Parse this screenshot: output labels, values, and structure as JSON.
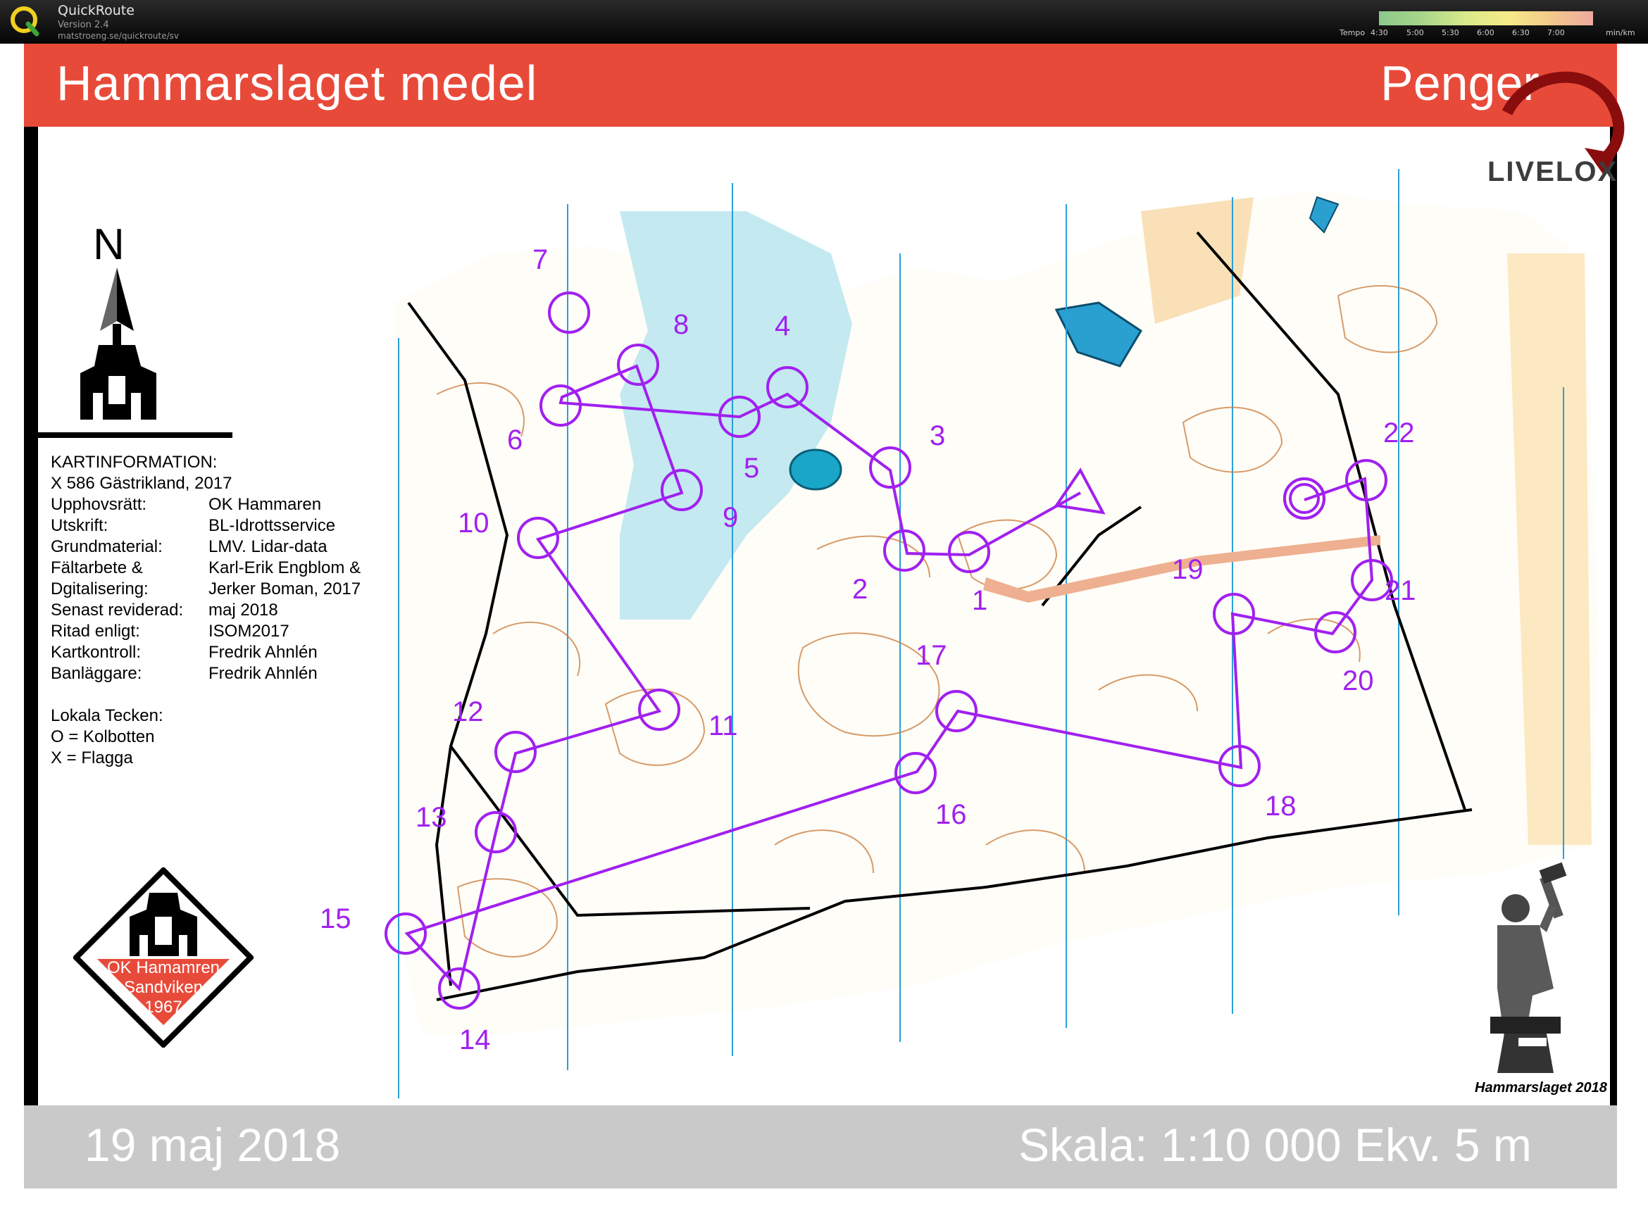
{
  "window": {
    "app_name": "QuickRoute",
    "version": "Version 2.4",
    "url": "matstroeng.se/quickroute/sv",
    "app_icon": "quickroute-q-icon"
  },
  "tempo_legend": {
    "label": "Tempo",
    "ticks": [
      "4:30",
      "5:00",
      "5:30",
      "6:00",
      "6:30",
      "7:00"
    ],
    "unit": "min/km",
    "gradient_colors": [
      "#8cc88c",
      "#d8ea8a",
      "#f6ea88",
      "#eeaaa0"
    ]
  },
  "map": {
    "title": "Hammarslaget medel",
    "course": "Penger",
    "brand": "LIVELOX",
    "north_label": "N",
    "info": {
      "heading": "KARTINFORMATION:",
      "map_id": "X 586 Gästrikland, 2017",
      "rows": [
        {
          "k": "Upphovsrätt:",
          "v": "OK Hammaren"
        },
        {
          "k": "Utskrift:",
          "v": "BL-Idrottsservice"
        },
        {
          "k": "Grundmaterial:",
          "v": "LMV. Lidar-data"
        },
        {
          "k": "Fältarbete &",
          "v": "Karl-Erik Engblom &"
        },
        {
          "k": "Dgitalisering:",
          "v": "Jerker Boman, 2017"
        },
        {
          "k": "Senast reviderad:",
          "v": "maj 2018"
        },
        {
          "k": "Ritad enligt:",
          "v": "ISOM2017"
        },
        {
          "k": "Kartkontroll:",
          "v": "Fredrik Ahnlén"
        },
        {
          "k": "Banläggare:",
          "v": "Fredrik Ahnlén"
        }
      ],
      "local_heading": "Lokala Tecken:",
      "local_1": "O = Kolbotten",
      "local_2": "X = Flagga"
    },
    "club": {
      "line1": "OK Hamamren",
      "line2": "Sandviken",
      "line3": "1967"
    },
    "event_caption": "Hammarslaget 2018",
    "date": "19 maj 2018",
    "scale": "Skala: 1:10 000 Ekv. 5 m",
    "colors": {
      "header": "#e84a3a",
      "course": "#a020f0",
      "water": "#9fd7e6",
      "contour": "#c87a3a",
      "footer": "#c9c9c9"
    },
    "controls": [
      {
        "n": "1",
        "label": "1"
      },
      {
        "n": "2",
        "label": "2"
      },
      {
        "n": "3",
        "label": "3"
      },
      {
        "n": "4",
        "label": "4"
      },
      {
        "n": "5",
        "label": "5"
      },
      {
        "n": "6",
        "label": "6"
      },
      {
        "n": "7",
        "label": "7"
      },
      {
        "n": "8",
        "label": "8"
      },
      {
        "n": "9",
        "label": "9"
      },
      {
        "n": "10",
        "label": "10"
      },
      {
        "n": "11",
        "label": "11"
      },
      {
        "n": "12",
        "label": "12"
      },
      {
        "n": "13",
        "label": "13"
      },
      {
        "n": "14",
        "label": "14"
      },
      {
        "n": "15",
        "label": "15"
      },
      {
        "n": "16",
        "label": "16"
      },
      {
        "n": "17",
        "label": "17"
      },
      {
        "n": "18",
        "label": "18"
      },
      {
        "n": "19",
        "label": "19"
      },
      {
        "n": "20",
        "label": "20"
      },
      {
        "n": "21",
        "label": "21"
      },
      {
        "n": "22",
        "label": "22"
      }
    ]
  }
}
